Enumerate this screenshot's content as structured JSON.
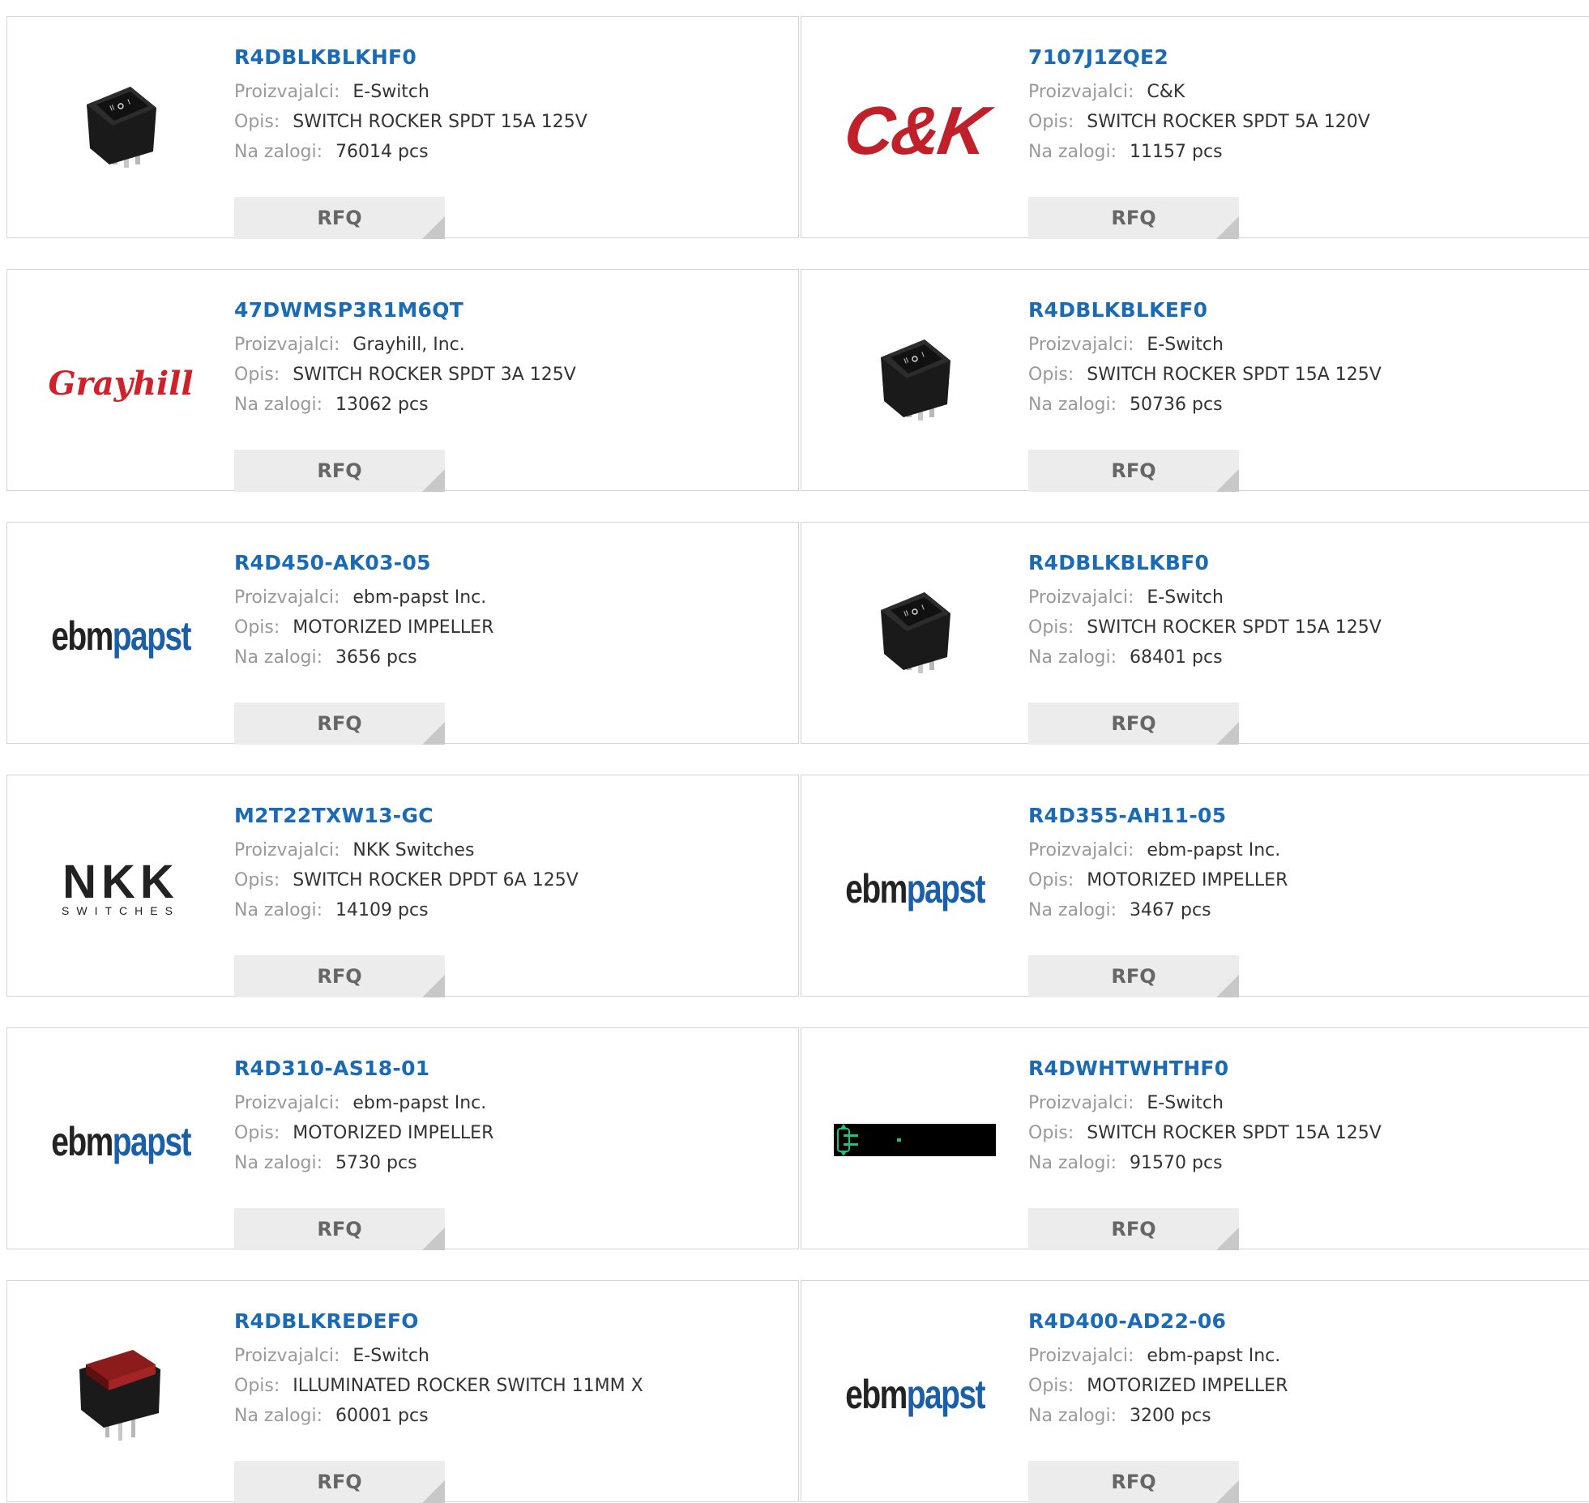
{
  "labels": {
    "manufacturer": "Proizvajalci:",
    "description": "Opis:",
    "stock": "Na zalogi:",
    "rfq": "RFQ"
  },
  "products": [
    {
      "part": "R4DBLKBLKHF0",
      "manufacturer": "E-Switch",
      "description": "SWITCH ROCKER SPDT 15A 125V",
      "stock": "76014 pcs",
      "image": "black-rocker-switch"
    },
    {
      "part": "7107J1ZQE2",
      "manufacturer": "C&K",
      "description": "SWITCH ROCKER SPDT 5A 120V",
      "stock": "11157 pcs",
      "image": "ck-logo",
      "logo_text": "C&K"
    },
    {
      "part": "47DWMSP3R1M6QT",
      "manufacturer": "Grayhill, Inc.",
      "description": "SWITCH ROCKER SPDT 3A 125V",
      "stock": "13062 pcs",
      "image": "grayhill-logo",
      "logo_text": "Grayhill"
    },
    {
      "part": "R4DBLKBLKEF0",
      "manufacturer": "E-Switch",
      "description": "SWITCH ROCKER SPDT 15A 125V",
      "stock": "50736 pcs",
      "image": "black-rocker-switch"
    },
    {
      "part": "R4D450-AK03-05",
      "manufacturer": "ebm-papst Inc.",
      "description": "MOTORIZED IMPELLER",
      "stock": "3656 pcs",
      "image": "ebmpapst-logo"
    },
    {
      "part": "R4DBLKBLKBF0",
      "manufacturer": "E-Switch",
      "description": "SWITCH ROCKER SPDT 15A 125V",
      "stock": "68401 pcs",
      "image": "black-rocker-switch"
    },
    {
      "part": "M2T22TXW13-GC",
      "manufacturer": "NKK Switches",
      "description": "SWITCH ROCKER DPDT 6A 125V",
      "stock": "14109 pcs",
      "image": "nkk-logo"
    },
    {
      "part": "R4D355-AH11-05",
      "manufacturer": "ebm-papst Inc.",
      "description": "MOTORIZED IMPELLER",
      "stock": "3467 pcs",
      "image": "ebmpapst-logo"
    },
    {
      "part": "R4D310-AS18-01",
      "manufacturer": "ebm-papst Inc.",
      "description": "MOTORIZED IMPELLER",
      "stock": "5730 pcs",
      "image": "ebmpapst-logo"
    },
    {
      "part": "R4DWHTWHTHF0",
      "manufacturer": "E-Switch",
      "description": "SWITCH ROCKER SPDT 15A 125V",
      "stock": "91570 pcs",
      "image": "black-strip-image"
    },
    {
      "part": "R4DBLKREDEFO",
      "manufacturer": "E-Switch",
      "description": "ILLUMINATED ROCKER SWITCH 11MM X",
      "stock": "60001 pcs",
      "image": "red-rocker-switch"
    },
    {
      "part": "R4D400-AD22-06",
      "manufacturer": "ebm-papst Inc.",
      "description": "MOTORIZED IMPELLER",
      "stock": "3200 pcs",
      "image": "ebmpapst-logo"
    }
  ]
}
